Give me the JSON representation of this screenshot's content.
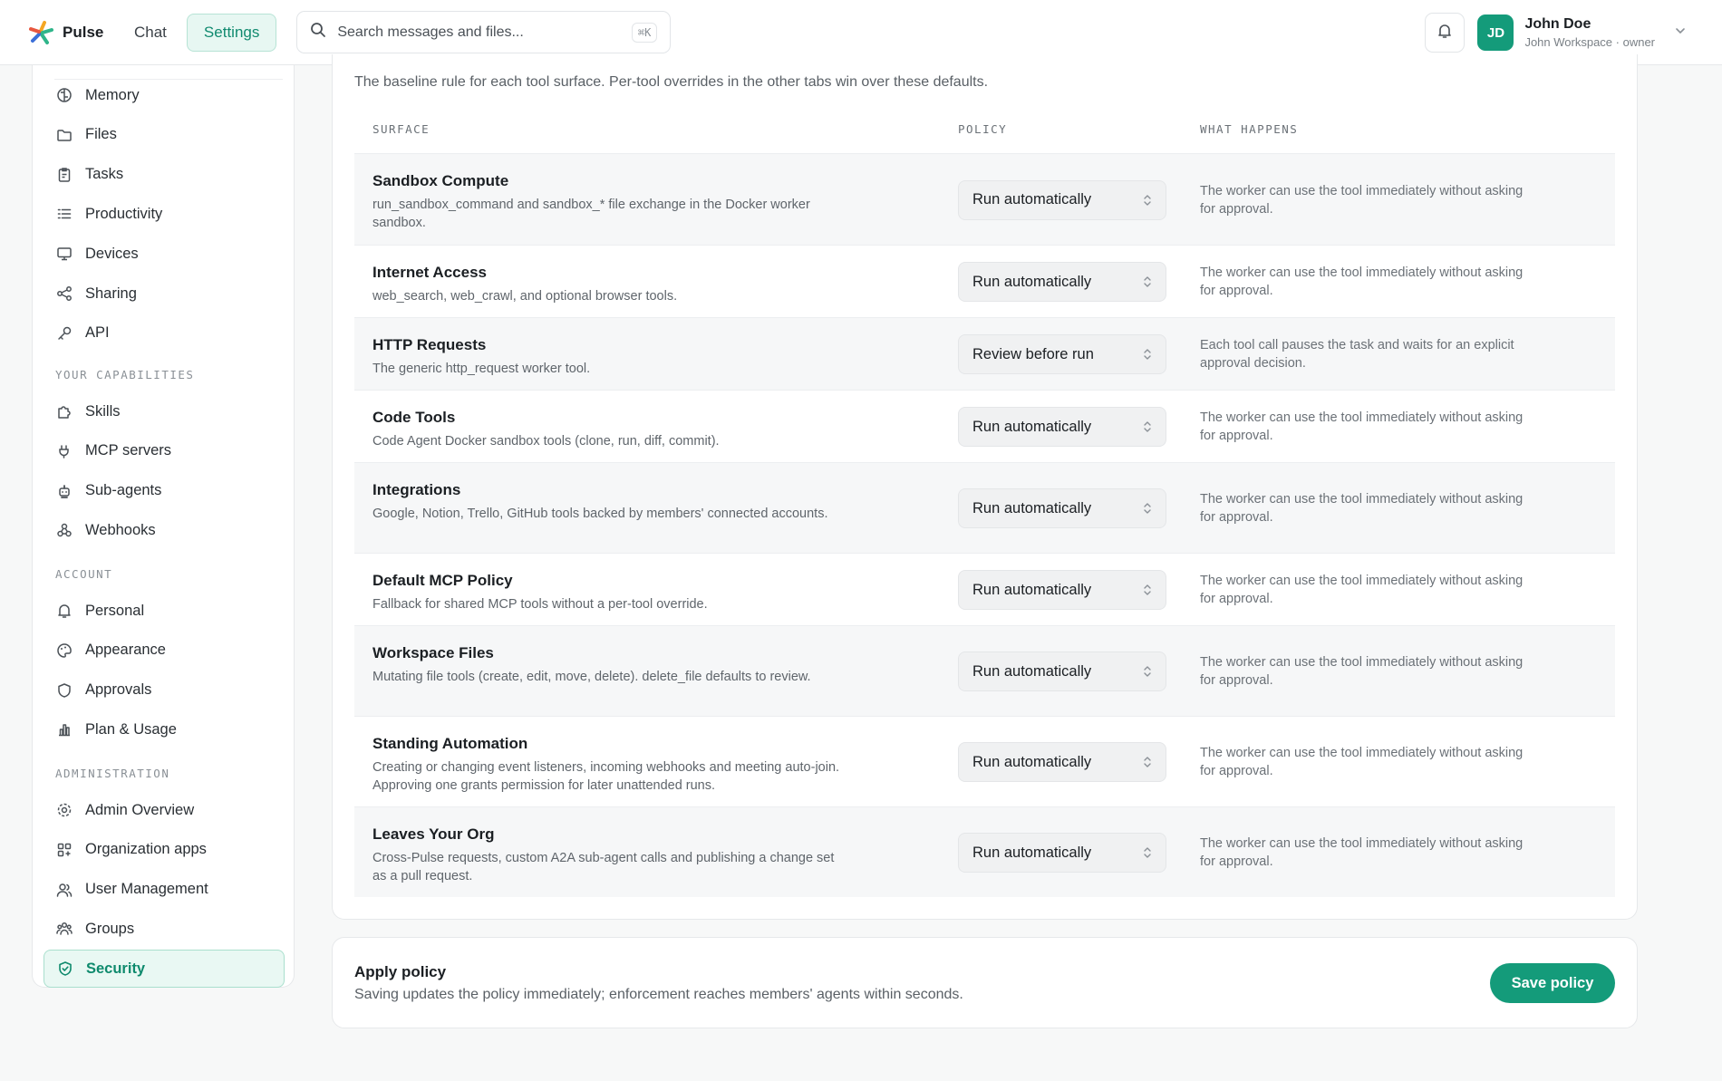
{
  "app": {
    "name": "Pulse",
    "nav": [
      "Chat",
      "Settings"
    ],
    "active_nav": "Settings"
  },
  "search": {
    "placeholder": "Search messages and files...",
    "shortcut": "⌘K"
  },
  "user": {
    "initials": "JD",
    "name": "John Doe",
    "subtitle": "John Workspace · owner"
  },
  "colors": {
    "accent": "#149b7a",
    "accent_light": "#e9f8f3"
  },
  "sidebar": {
    "items_top": [
      {
        "label": "Memory",
        "icon": "brain-icon"
      },
      {
        "label": "Files",
        "icon": "folder-icon"
      },
      {
        "label": "Tasks",
        "icon": "clipboard-icon"
      },
      {
        "label": "Productivity",
        "icon": "list-icon"
      },
      {
        "label": "Devices",
        "icon": "monitor-icon"
      },
      {
        "label": "Sharing",
        "icon": "share-icon"
      },
      {
        "label": "API",
        "icon": "key-icon"
      }
    ],
    "section_capabilities": "YOUR CAPABILITIES",
    "items_capabilities": [
      {
        "label": "Skills",
        "icon": "puzzle-icon"
      },
      {
        "label": "MCP servers",
        "icon": "plug-icon"
      },
      {
        "label": "Sub-agents",
        "icon": "bot-icon"
      },
      {
        "label": "Webhooks",
        "icon": "webhook-icon"
      }
    ],
    "section_account": "ACCOUNT",
    "items_account": [
      {
        "label": "Personal",
        "icon": "bell-icon"
      },
      {
        "label": "Appearance",
        "icon": "palette-icon"
      },
      {
        "label": "Approvals",
        "icon": "shield-icon"
      },
      {
        "label": "Plan & Usage",
        "icon": "chart-icon"
      }
    ],
    "section_admin": "ADMINISTRATION",
    "items_admin": [
      {
        "label": "Admin Overview",
        "icon": "gear-icon"
      },
      {
        "label": "Organization apps",
        "icon": "apps-icon"
      },
      {
        "label": "User Management",
        "icon": "users-icon"
      },
      {
        "label": "Groups",
        "icon": "group-icon"
      },
      {
        "label": "Security",
        "icon": "shield-check-icon",
        "active": true
      }
    ]
  },
  "policy": {
    "description": "The baseline rule for each tool surface. Per-tool overrides in the other tabs win over these defaults.",
    "columns": [
      "SURFACE",
      "POLICY",
      "WHAT HAPPENS"
    ],
    "rows": [
      {
        "title": "Sandbox Compute",
        "desc": "run_sandbox_command and sandbox_* file exchange in the Docker worker sandbox.",
        "policy": "Run automatically",
        "what": "The worker can use the tool immediately without asking for approval."
      },
      {
        "title": "Internet Access",
        "desc": "web_search, web_crawl, and optional browser tools.",
        "policy": "Run automatically",
        "what": "The worker can use the tool immediately without asking for approval."
      },
      {
        "title": "HTTP Requests",
        "desc": "The generic http_request worker tool.",
        "policy": "Review before run",
        "what": "Each tool call pauses the task and waits for an explicit approval decision."
      },
      {
        "title": "Code Tools",
        "desc": "Code Agent Docker sandbox tools (clone, run, diff, commit).",
        "policy": "Run automatically",
        "what": "The worker can use the tool immediately without asking for approval."
      },
      {
        "title": "Integrations",
        "desc": "Google, Notion, Trello, GitHub tools backed by members' connected accounts.",
        "policy": "Run automatically",
        "what": "The worker can use the tool immediately without asking for approval."
      },
      {
        "title": "Default MCP Policy",
        "desc": "Fallback for shared MCP tools without a per-tool override.",
        "policy": "Run automatically",
        "what": "The worker can use the tool immediately without asking for approval."
      },
      {
        "title": "Workspace Files",
        "desc": "Mutating file tools (create, edit, move, delete). delete_file defaults to review.",
        "policy": "Run automatically",
        "what": "The worker can use the tool immediately without asking for approval."
      },
      {
        "title": "Standing Automation",
        "desc": "Creating or changing event listeners, incoming webhooks and meeting auto-join. Approving one grants permission for later unattended runs.",
        "policy": "Run automatically",
        "what": "The worker can use the tool immediately without asking for approval."
      },
      {
        "title": "Leaves Your Org",
        "desc": "Cross-Pulse requests, custom A2A sub-agent calls and publishing a change set as a pull request.",
        "policy": "Run automatically",
        "what": "The worker can use the tool immediately without asking for approval."
      }
    ]
  },
  "apply": {
    "title": "Apply policy",
    "desc": "Saving updates the policy immediately; enforcement reaches members' agents within seconds.",
    "button": "Save policy"
  }
}
